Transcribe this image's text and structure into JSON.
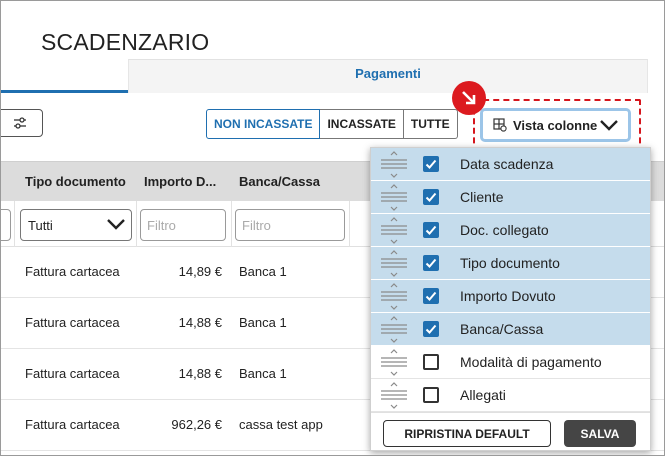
{
  "page": {
    "title": "SCADENZARIO"
  },
  "tabs": {
    "right_label": "Pagamenti"
  },
  "toolbar": {
    "segments": [
      "NON INCASSATE",
      "INCASSATE",
      "TUTTE"
    ],
    "vista_label": "Vista colonne"
  },
  "table": {
    "headers": [
      "Tipo documento",
      "Importo D...",
      "Banca/Cassa"
    ],
    "filters": {
      "tipo_select": "Tutti",
      "placeholder": "Filtro"
    },
    "rows": [
      {
        "tipo": "Fattura cartacea",
        "importo": "14,89 €",
        "banca": "Banca 1"
      },
      {
        "tipo": "Fattura cartacea",
        "importo": "14,88 €",
        "banca": "Banca 1"
      },
      {
        "tipo": "Fattura cartacea",
        "importo": "14,88 €",
        "banca": "Banca 1"
      },
      {
        "tipo": "Fattura cartacea",
        "importo": "962,26 €",
        "banca": "cassa test app"
      }
    ]
  },
  "columns_menu": {
    "items": [
      {
        "label": "Data scadenza",
        "checked": true
      },
      {
        "label": "Cliente",
        "checked": true
      },
      {
        "label": "Doc. collegato",
        "checked": true
      },
      {
        "label": "Tipo documento",
        "checked": true
      },
      {
        "label": "Importo Dovuto",
        "checked": true
      },
      {
        "label": "Banca/Cassa",
        "checked": true
      },
      {
        "label": "Modalità di pagamento",
        "checked": false
      },
      {
        "label": "Allegati",
        "checked": false
      }
    ],
    "reset_label": "RIPRISTINA DEFAULT",
    "save_label": "SALVA"
  },
  "colors": {
    "accent": "#1f6fb0",
    "highlight": "#dc1a1f",
    "checked_row": "#c5dcec"
  }
}
